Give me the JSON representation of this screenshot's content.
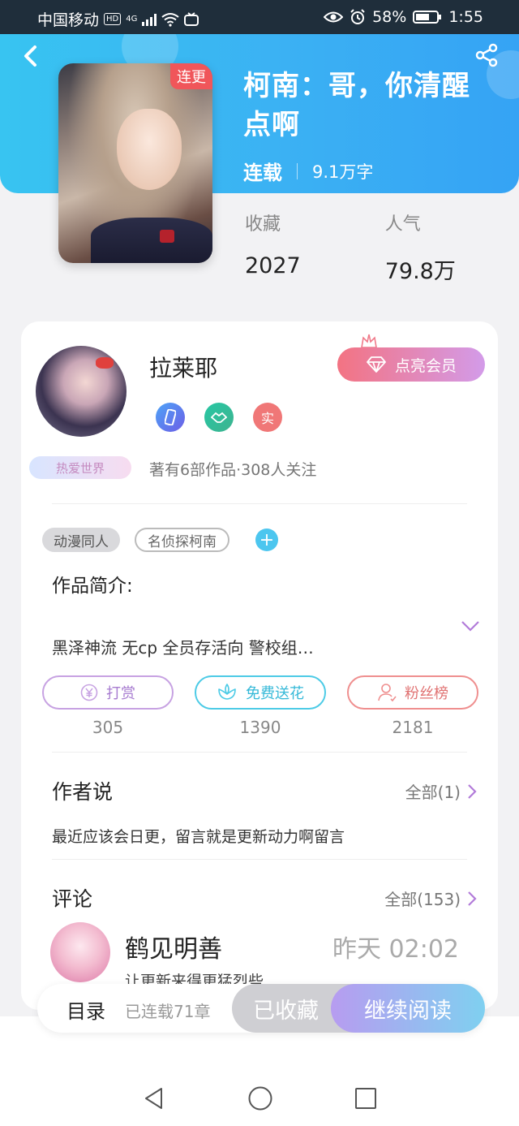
{
  "status_bar": {
    "carrier": "中国移动",
    "hd": "HD",
    "net": "4G",
    "battery": "58%",
    "time": "1:55"
  },
  "book": {
    "tag": "连更",
    "title": "柯南：哥，你清醒点啊",
    "status": "连载",
    "word_count": "9.1万字",
    "stats": [
      {
        "label": "收藏",
        "value": "2027"
      },
      {
        "label": "人气",
        "value": "79.8万"
      }
    ]
  },
  "author": {
    "name": "拉莱耶",
    "fan_badge": "热爱世界",
    "real_badge": "实",
    "meta": "著有6部作品·308人关注",
    "vip_button": "点亮会员"
  },
  "tags": [
    "动漫同人",
    "名侦探柯南"
  ],
  "intro": {
    "label": "作品简介:",
    "text": "黑泽神流 无cp 全员存活向 警校组…"
  },
  "actions": [
    {
      "label": "打赏",
      "count": "305",
      "icon": "yen-icon"
    },
    {
      "label": "免费送花",
      "count": "1390",
      "icon": "flower-icon"
    },
    {
      "label": "粉丝榜",
      "count": "2181",
      "icon": "person-icon"
    }
  ],
  "author_says": {
    "title": "作者说",
    "more": "全部(1)",
    "text": "最近应该会日更，留言就是更新动力啊留言"
  },
  "comments": {
    "title": "评论",
    "more": "全部(153)",
    "first": {
      "name": "鹤见明善",
      "time": "昨天 02:02",
      "text": "让更新来得更猛烈些"
    }
  },
  "bottom_bar": {
    "toc": "目录",
    "chapters": "已连载71章",
    "collected": "已收藏",
    "read": "继续阅读"
  },
  "colors": {
    "header_start": "#38c4f1",
    "header_end": "#35a3f4",
    "vip_gradient": [
      "#f37382",
      "#d39be9"
    ],
    "read_gradient": [
      "#b79cf0",
      "#7fd0f0"
    ]
  }
}
